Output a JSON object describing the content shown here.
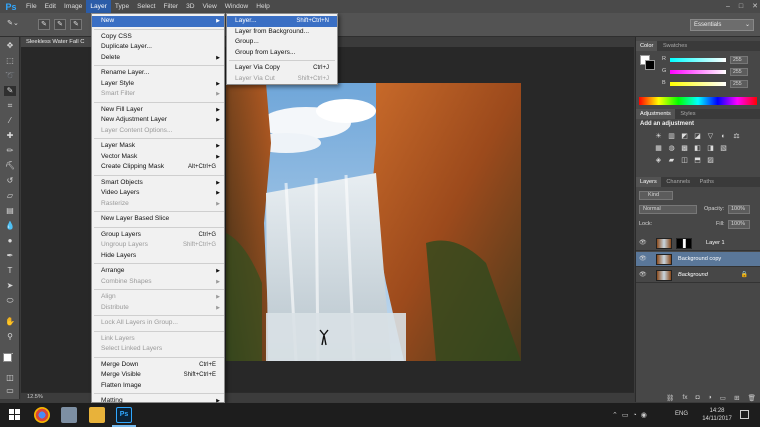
{
  "app": {
    "logo": "Ps"
  },
  "menubar": {
    "items": [
      "File",
      "Edit",
      "Image",
      "Layer",
      "Type",
      "Select",
      "Filter",
      "3D",
      "View",
      "Window",
      "Help"
    ],
    "active": "Layer",
    "window_controls": [
      "–",
      "□",
      "✕"
    ]
  },
  "optionsbar": {
    "workspace": "Essentials",
    "workspace_arrow": "⌄"
  },
  "document": {
    "tab_title": "Sleekless Water Fall C",
    "zoom": "12.5%"
  },
  "layer_menu": {
    "items": [
      {
        "label": "New",
        "shortcut": "",
        "submenu": true,
        "disabled": false,
        "highlight": true
      },
      {
        "label": "Copy CSS",
        "shortcut": "",
        "submenu": false,
        "disabled": false
      },
      {
        "label": "Duplicate Layer...",
        "shortcut": "",
        "submenu": false,
        "disabled": false
      },
      {
        "label": "Delete",
        "shortcut": "",
        "submenu": true,
        "disabled": false
      },
      {
        "label": "Rename Layer...",
        "shortcut": "",
        "submenu": false,
        "disabled": false
      },
      {
        "label": "Layer Style",
        "shortcut": "",
        "submenu": true,
        "disabled": false
      },
      {
        "label": "Smart Filter",
        "shortcut": "",
        "submenu": true,
        "disabled": true
      },
      {
        "label": "New Fill Layer",
        "shortcut": "",
        "submenu": true,
        "disabled": false
      },
      {
        "label": "New Adjustment Layer",
        "shortcut": "",
        "submenu": true,
        "disabled": false
      },
      {
        "label": "Layer Content Options...",
        "shortcut": "",
        "submenu": false,
        "disabled": true
      },
      {
        "label": "Layer Mask",
        "shortcut": "",
        "submenu": true,
        "disabled": false
      },
      {
        "label": "Vector Mask",
        "shortcut": "",
        "submenu": true,
        "disabled": false
      },
      {
        "label": "Create Clipping Mask",
        "shortcut": "Alt+Ctrl+G",
        "submenu": false,
        "disabled": false
      },
      {
        "label": "Smart Objects",
        "shortcut": "",
        "submenu": true,
        "disabled": false
      },
      {
        "label": "Video Layers",
        "shortcut": "",
        "submenu": true,
        "disabled": false
      },
      {
        "label": "Rasterize",
        "shortcut": "",
        "submenu": true,
        "disabled": true
      },
      {
        "label": "New Layer Based Slice",
        "shortcut": "",
        "submenu": false,
        "disabled": false
      },
      {
        "label": "Group Layers",
        "shortcut": "Ctrl+G",
        "submenu": false,
        "disabled": false
      },
      {
        "label": "Ungroup Layers",
        "shortcut": "Shift+Ctrl+G",
        "submenu": false,
        "disabled": true
      },
      {
        "label": "Hide Layers",
        "shortcut": "",
        "submenu": false,
        "disabled": false
      },
      {
        "label": "Arrange",
        "shortcut": "",
        "submenu": true,
        "disabled": false
      },
      {
        "label": "Combine Shapes",
        "shortcut": "",
        "submenu": true,
        "disabled": true
      },
      {
        "label": "Align",
        "shortcut": "",
        "submenu": true,
        "disabled": true
      },
      {
        "label": "Distribute",
        "shortcut": "",
        "submenu": true,
        "disabled": true
      },
      {
        "label": "Lock All Layers in Group...",
        "shortcut": "",
        "submenu": false,
        "disabled": true
      },
      {
        "label": "Link Layers",
        "shortcut": "",
        "submenu": false,
        "disabled": true
      },
      {
        "label": "Select Linked Layers",
        "shortcut": "",
        "submenu": false,
        "disabled": true
      },
      {
        "label": "Merge Down",
        "shortcut": "Ctrl+E",
        "submenu": false,
        "disabled": false
      },
      {
        "label": "Merge Visible",
        "shortcut": "Shift+Ctrl+E",
        "submenu": false,
        "disabled": false
      },
      {
        "label": "Flatten Image",
        "shortcut": "",
        "submenu": false,
        "disabled": false
      },
      {
        "label": "Matting",
        "shortcut": "",
        "submenu": true,
        "disabled": false
      }
    ]
  },
  "new_submenu": {
    "items": [
      {
        "label": "Layer...",
        "shortcut": "Shift+Ctrl+N",
        "highlight": true,
        "disabled": false
      },
      {
        "label": "Layer from Background...",
        "shortcut": "",
        "disabled": false
      },
      {
        "label": "Group...",
        "shortcut": "",
        "disabled": false
      },
      {
        "label": "Group from Layers...",
        "shortcut": "",
        "disabled": false
      },
      {
        "label": "Layer Via Copy",
        "shortcut": "Ctrl+J",
        "disabled": false
      },
      {
        "label": "Layer Via Cut",
        "shortcut": "Shift+Ctrl+J",
        "disabled": true
      }
    ]
  },
  "color_panel": {
    "tabs": [
      "Color",
      "Swatches"
    ],
    "channels": [
      {
        "label": "R",
        "value": "255"
      },
      {
        "label": "G",
        "value": "255"
      },
      {
        "label": "B",
        "value": "255"
      }
    ]
  },
  "adjustments_panel": {
    "tabs": [
      "Adjustments",
      "Styles"
    ],
    "title": "Add an adjustment"
  },
  "layers_panel": {
    "tabs": [
      "Layers",
      "Channels",
      "Paths"
    ],
    "kind": "Kind",
    "blend_mode": "Normal",
    "opacity_label": "Opacity:",
    "opacity": "100%",
    "lock_label": "Lock:",
    "fill_label": "Fill:",
    "fill": "100%",
    "layers": [
      {
        "name": "Layer 1",
        "selected": false,
        "italic": false
      },
      {
        "name": "Background copy",
        "selected": true,
        "italic": false
      },
      {
        "name": "Background",
        "selected": false,
        "italic": true
      }
    ],
    "footer_icons": [
      "link-icon",
      "fx-icon",
      "mask-icon",
      "adjustment-icon",
      "folder-icon",
      "new-layer-icon",
      "trash-icon"
    ]
  },
  "taskbar": {
    "language": "ENG",
    "time": "14:28",
    "date": "14/11/2017"
  },
  "colors": {
    "menu_highlight": "#3a6fc4",
    "selected_layer": "#5a7799",
    "panel_bg": "#474747"
  }
}
